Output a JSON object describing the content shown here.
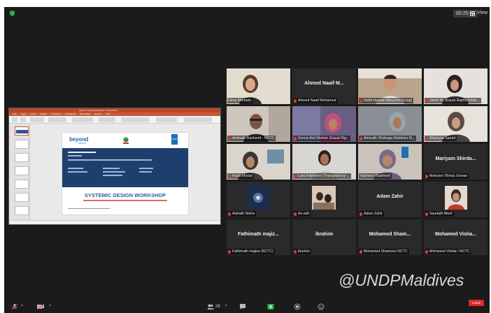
{
  "meeting": {
    "timer": "00:25:43",
    "view_label": "View",
    "leave_label": "Leave",
    "participants_count": "28"
  },
  "shared_screen": {
    "app_title": "Systemic Design Workshop - PowerPoint",
    "menu": [
      "File",
      "Home",
      "Insert",
      "Design",
      "Transitions",
      "Animations",
      "Slide Show",
      "Review",
      "View"
    ],
    "slide": {
      "logo": "beyond",
      "logo_sub": "GROUP",
      "undp": "UNDP",
      "title": "SYSTEMIC DESIGN WORKSHOP"
    }
  },
  "participants": [
    {
      "name": "Hana Murtada",
      "video": true,
      "muted": false
    },
    {
      "name": "Ahmed Naaif Mohamed",
      "display": "Ahmed Naaif M...",
      "video": false,
      "muted": true
    },
    {
      "name": "Nabil Hassan (Beyond Group)",
      "video": true,
      "muted": true
    },
    {
      "name": "Jaleel M. (Equal Rights Initiat...",
      "video": true,
      "muted": true
    },
    {
      "name": "Aminath Rasheed - NCTC",
      "video": true,
      "muted": true
    },
    {
      "name": "Zeena Abd Muhsin (Equal Rig...",
      "video": true,
      "muted": true
    },
    {
      "name": "Aminath Shahuga Maldives M...",
      "video": true,
      "muted": true
    },
    {
      "name": "Shuhuna Saeed",
      "video": true,
      "muted": true
    },
    {
      "name": "Fazia Murad",
      "video": true,
      "muted": true
    },
    {
      "name": "Lara Fakheem (Transparency ...",
      "video": true,
      "muted": true
    },
    {
      "name": "Yazmeen Rasheed",
      "video": true,
      "muted": false
    },
    {
      "name": "Mariyam Shirda Usman",
      "display": "Mariyam Shirda...",
      "video": false,
      "muted": true
    },
    {
      "name": "Aishath Nisha",
      "video": false,
      "muted": true
    },
    {
      "name": "As-adh",
      "video": false,
      "muted": true
    },
    {
      "name": "Adam Zahir",
      "display": "Adam Zahir",
      "video": false,
      "muted": true
    },
    {
      "name": "Saudath Afeef",
      "video": false,
      "muted": true
    },
    {
      "name": "Fathimath majiza (NCTC)",
      "display": "Fathimath majiz...",
      "video": false,
      "muted": true
    },
    {
      "name": "ibrahim",
      "display": "ibrahim",
      "video": false,
      "muted": true
    },
    {
      "name": "Mohamed Shamoon NCTC",
      "display": "Mohamed Sham...",
      "video": false,
      "muted": true
    },
    {
      "name": "Mohamed Vishal / NCTC",
      "display": "Mohamed Visha...",
      "video": false,
      "muted": true
    }
  ],
  "watermark": "@UNDPMaldives",
  "colors": {
    "background": "#1b1b1b",
    "tile": "#2a2a2a",
    "active_speaker": "#9ec63a",
    "muted": "#e53935",
    "leave": "#e02828"
  }
}
